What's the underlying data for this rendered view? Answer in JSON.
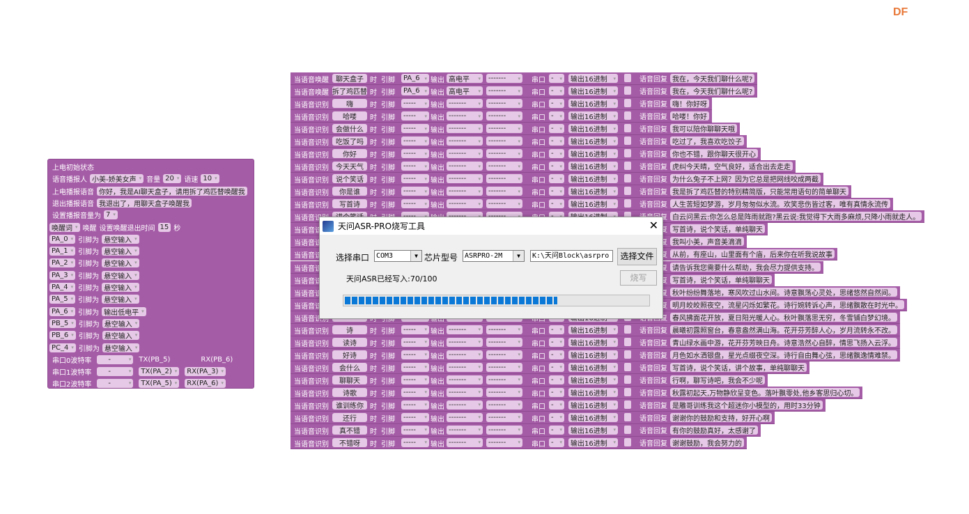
{
  "logo": "DF",
  "colors": {
    "block": "#a55ca7",
    "field": "#e6c9e6",
    "accent": "#0a78d7",
    "logo": "#e8793a"
  },
  "init": {
    "title": "上电初始状态",
    "speaker_label": "语音播报人",
    "speaker": "小美-娇美女声",
    "volume_label": "音量",
    "volume": "20",
    "speed_label": "语速",
    "speed": "10",
    "boot_label": "上电播报语音",
    "boot_text": "你好，我是AI聊天盒子，请用拆了鸡匹替唤醒我",
    "exit_label": "退出播报语音",
    "exit_text": "我退出了，用聊天盒子唤醒我",
    "setvol_label": "设置播报音量为",
    "setvol": "7",
    "wake_word": "唤醒词",
    "wake_label": "唤醒",
    "timeout_label": "设置唤醒退出时间",
    "timeout": "15",
    "sec": "秒",
    "pin_label": "引脚为",
    "pins": [
      {
        "pin": "PA_0",
        "mode": "悬空输入"
      },
      {
        "pin": "PA_1",
        "mode": "悬空输入"
      },
      {
        "pin": "PA_2",
        "mode": "悬空输入"
      },
      {
        "pin": "PA_3",
        "mode": "悬空输入"
      },
      {
        "pin": "PA_4",
        "mode": "悬空输入"
      },
      {
        "pin": "PA_5",
        "mode": "悬空输入"
      },
      {
        "pin": "PA_6",
        "mode": "输出低电平"
      },
      {
        "pin": "PB_5",
        "mode": "悬空输入"
      },
      {
        "pin": "PB_6",
        "mode": "悬空输入"
      },
      {
        "pin": "PC_4",
        "mode": "悬空输入"
      }
    ],
    "uarts": [
      {
        "label": "串口0波特率",
        "baud": "-",
        "tx": "TX(PB_5)",
        "rx": "RX(PB_6)",
        "dd": false
      },
      {
        "label": "串口1波特率",
        "baud": "-",
        "tx": "TX(PA_2)",
        "rx": "RX(PA_3)",
        "dd": true
      },
      {
        "label": "串口2波特率",
        "baud": "-",
        "tx": "TX(PA_5)",
        "rx": "RX(PA_6)",
        "dd": true
      }
    ]
  },
  "row_labels": {
    "when": "当语音识别",
    "when_wake": "当语音唤醒",
    "time": "时",
    "pin": "引脚",
    "out": "输出",
    "serial": "串口",
    "reply": "语音回复",
    "hex": "输出16进制",
    "serial_val": "-"
  },
  "rows": [
    {
      "wake": true,
      "kw": "聊天盒子",
      "pin": "PA_6",
      "level": "高电平",
      "extra": "-------",
      "reply": "我在，今天我们聊什么呢?"
    },
    {
      "wake": true,
      "kw": "拆了鸡匹替",
      "pin": "PA_6",
      "level": "高电平",
      "extra": "-------",
      "reply": "我在，今天我们聊什么呢?"
    },
    {
      "kw": "嗨",
      "pin": "-----",
      "level": "-------",
      "extra": "-------",
      "reply": "嗨！你好呀"
    },
    {
      "kw": "哈喽",
      "pin": "-----",
      "level": "-------",
      "extra": "-------",
      "reply": "哈喽！你好"
    },
    {
      "kw": "会做什么",
      "pin": "-----",
      "level": "-------",
      "extra": "-------",
      "reply": "我可以陪你聊聊天哦"
    },
    {
      "kw": "吃饭了吗",
      "pin": "-----",
      "level": "-------",
      "extra": "-------",
      "reply": "吃过了，我喜欢吃饺子"
    },
    {
      "kw": "你好",
      "pin": "-----",
      "level": "-------",
      "extra": "-------",
      "reply": "你也不错，跟你聊天很开心"
    },
    {
      "kw": "今天天气",
      "pin": "-----",
      "level": "-------",
      "extra": "-------",
      "reply": "虎纠今天晴，空气良好，适合出去走走"
    },
    {
      "kw": "说个笑话",
      "pin": "-----",
      "level": "-------",
      "extra": "-------",
      "reply": "为什么兔子不上网？因为它总是把网线咬成两截"
    },
    {
      "kw": "你是谁",
      "pin": "-----",
      "level": "-------",
      "extra": "-------",
      "reply": "我是拆了鸡匹替的特别精简版，只能常用语句的简单聊天"
    },
    {
      "kw": "写首诗",
      "pin": "-----",
      "level": "-------",
      "extra": "-------",
      "reply": "人生苦短如梦游，岁月匆匆似水流。欢笑悲伤皆过客，唯有真情永流传"
    },
    {
      "kw": "讲个笑话",
      "pin": "-----",
      "level": "-------",
      "extra": "-------",
      "reply": "白云问黑云:你怎么总是阵雨就跑?黑云说:我觉得下大雨多麻烦,只降小雨就走人。"
    },
    {
      "kw": "",
      "pin": "-----",
      "level": "-------",
      "extra": "-------",
      "reply": "写首诗，说个笑话，单纯聊天"
    },
    {
      "kw": "",
      "pin": "-----",
      "level": "-------",
      "extra": "-------",
      "reply": "我叫小美，声音美滴滴"
    },
    {
      "kw": "",
      "pin": "-----",
      "level": "-------",
      "extra": "-------",
      "reply": "从前，有座山，山里面有个庙，后来你在听我说故事"
    },
    {
      "kw": "",
      "pin": "-----",
      "level": "-------",
      "extra": "-------",
      "reply": "请告诉我您需要什么帮助，我会尽力提供支持。"
    },
    {
      "kw": "",
      "pin": "-----",
      "level": "-------",
      "extra": "-------",
      "reply": "写首诗，说个笑话，单纯聊聊天"
    },
    {
      "kw": "",
      "pin": "-----",
      "level": "-------",
      "extra": "-------",
      "reply": "秋叶纷纷舞落地，寒风吹过山水间。诗意飘荡心灵处，思绪悠然自然间。"
    },
    {
      "kw": "",
      "pin": "-----",
      "level": "-------",
      "extra": "-------",
      "reply": "明月皎皎照夜空，流星闪烁如繁花。诗行婉转诉心声，思绪飘散在时光中。"
    },
    {
      "kw": "",
      "pin": "-----",
      "level": "-------",
      "extra": "-------",
      "reply": "春风拂面花开放，夏日阳光暖人心。秋叶飘落思无穷，冬雪铺白梦幻境。"
    },
    {
      "kw": "诗",
      "pin": "-----",
      "level": "-------",
      "extra": "-------",
      "reply": "晨曦初露照窗台，春意盎然满山海。花开芬芳醉人心，岁月流转永不改。"
    },
    {
      "kw": "读诗",
      "pin": "-----",
      "level": "-------",
      "extra": "-------",
      "reply": "青山绿水画中游，花开芬芳映日舟。诗意浩然心自醉，情思飞扬入云浮。"
    },
    {
      "kw": "好诗",
      "pin": "-----",
      "level": "-------",
      "extra": "-------",
      "reply": "月色如水洒银盘，星光点缀夜空深。诗行自由舞心弦，思绪飘逸情难禁。"
    },
    {
      "kw": "会什么",
      "pin": "-----",
      "level": "-------",
      "extra": "-------",
      "reply": "写首诗，说个笑话，讲个故事，单纯聊聊天"
    },
    {
      "kw": "聊聊天",
      "pin": "-----",
      "level": "-------",
      "extra": "-------",
      "reply": "行啊，聊写诗吧，我会不少呢"
    },
    {
      "kw": "诗歌",
      "pin": "-----",
      "level": "-------",
      "extra": "-------",
      "reply": "秋露初起天,万物静欣呈变色。落叶飘零处,他乡客思归心切。"
    },
    {
      "kw": "谁训练你",
      "pin": "-----",
      "level": "-------",
      "extra": "-------",
      "reply": "是雕哥训练我这个超迷你小模型的，用时33分钟"
    },
    {
      "kw": "还行",
      "pin": "-----",
      "level": "-------",
      "extra": "-------",
      "reply": "谢谢你的鼓励和支持，好开心啊"
    },
    {
      "kw": "真不错",
      "pin": "-----",
      "level": "-------",
      "extra": "-------",
      "reply": "有你的鼓励真好，太感谢了"
    },
    {
      "kw": "不错呀",
      "pin": "-----",
      "level": "-------",
      "extra": "-------",
      "reply": "谢谢鼓励，我会努力的"
    }
  ],
  "dialog": {
    "title": "天问ASR-PRO烧写工具",
    "port_label": "选择串口",
    "port": "COM3",
    "chip_label": "芯片型号",
    "chip": "ASRPRO-2M",
    "file_path": "K:\\天问Block\\asrpro",
    "select_file": "选择文件",
    "burn": "烧写",
    "status": "天问ASR已经写入:70/100",
    "progress_percent": 70
  }
}
